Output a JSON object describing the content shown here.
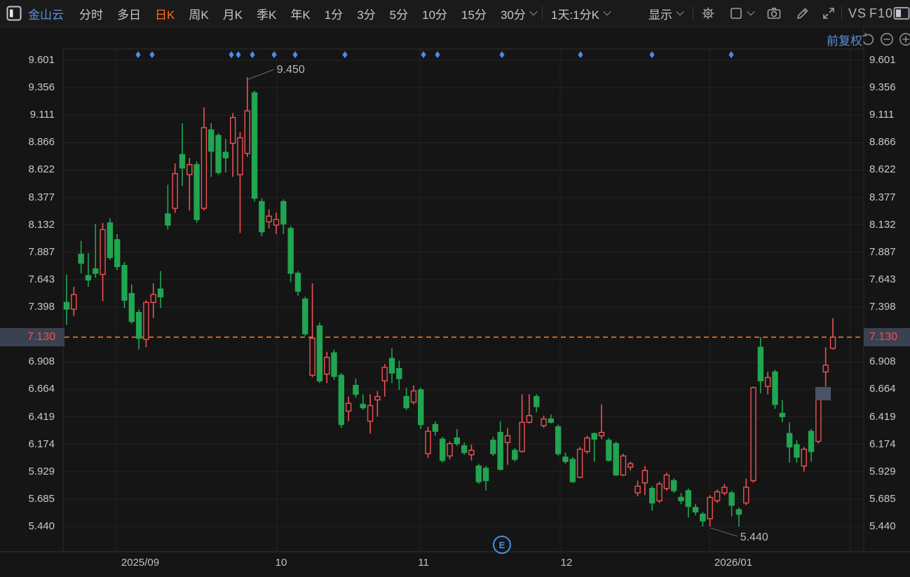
{
  "toolbar": {
    "symbol": "金山云",
    "tabs": [
      {
        "label": "分时",
        "active": false,
        "chevron": false
      },
      {
        "label": "多日",
        "active": false,
        "chevron": false
      },
      {
        "label": "日K",
        "active": true,
        "chevron": false
      },
      {
        "label": "周K",
        "active": false,
        "chevron": false
      },
      {
        "label": "月K",
        "active": false,
        "chevron": false
      },
      {
        "label": "季K",
        "active": false,
        "chevron": false
      },
      {
        "label": "年K",
        "active": false,
        "chevron": false
      },
      {
        "label": "1分",
        "active": false,
        "chevron": false
      },
      {
        "label": "3分",
        "active": false,
        "chevron": false
      },
      {
        "label": "5分",
        "active": false,
        "chevron": false
      },
      {
        "label": "10分",
        "active": false,
        "chevron": false
      },
      {
        "label": "15分",
        "active": false,
        "chevron": false
      },
      {
        "label": "30分",
        "active": false,
        "chevron": true
      }
    ],
    "period_selector": "1天:1分K",
    "display_menu": "显示",
    "vs_label": "VS",
    "f10_label": "F10",
    "icon_names": [
      "window-panel",
      "gear",
      "chart-style",
      "camera",
      "pencil",
      "fullscreen",
      "right-panel"
    ]
  },
  "chart_header": {
    "adjustment_mode": "前复权",
    "icon_names": [
      "undo",
      "zoom-out",
      "zoom-in"
    ]
  },
  "chart_data": {
    "type": "candlestick",
    "title": "金山云 日K 前复权",
    "current_price": "7.130",
    "high_annotation": "9.450",
    "low_annotation": "5.440",
    "event_marker_label": "E",
    "event_marker_x": 716,
    "y_ticks": [
      "9.601",
      "9.356",
      "9.111",
      "8.866",
      "8.622",
      "8.377",
      "8.132",
      "7.887",
      "7.643",
      "7.398",
      "6.908",
      "6.664",
      "6.419",
      "6.174",
      "5.929",
      "5.685",
      "5.440"
    ],
    "x_ticks": [
      {
        "label": "2025/09",
        "x": 200
      },
      {
        "label": "10",
        "x": 401
      },
      {
        "label": "11",
        "x": 604
      },
      {
        "label": "12",
        "x": 808
      },
      {
        "label": "2026/01",
        "x": 1046
      }
    ],
    "price_top": 9.601,
    "price_bottom": 5.44,
    "diamond_marker_xs": [
      197,
      217,
      330,
      340,
      360,
      391,
      421,
      492,
      604,
      624,
      716,
      828,
      930,
      1043
    ],
    "vertical_gridline_xs": [
      166,
      395,
      599,
      799,
      1012,
      1213
    ],
    "high_candle_index": 25,
    "low_candle_index": 89,
    "highlight_box": {
      "x": 1163,
      "y": 552,
      "w": 22,
      "h": 19
    },
    "candles": [
      [
        7.44,
        7.69,
        7.24,
        7.38
      ],
      [
        7.38,
        7.58,
        7.32,
        7.51
      ],
      [
        7.87,
        7.99,
        7.7,
        7.79
      ],
      [
        7.68,
        7.88,
        7.58,
        7.64
      ],
      [
        7.74,
        8.14,
        7.66,
        7.7
      ],
      [
        7.69,
        8.15,
        7.45,
        8.09
      ],
      [
        8.15,
        8.19,
        7.82,
        7.84
      ],
      [
        8.0,
        8.05,
        7.73,
        7.76
      ],
      [
        7.77,
        7.8,
        7.39,
        7.46
      ],
      [
        7.52,
        7.6,
        7.25,
        7.27
      ],
      [
        7.35,
        7.38,
        7.02,
        7.12
      ],
      [
        7.11,
        7.46,
        7.04,
        7.44
      ],
      [
        7.44,
        7.61,
        7.3,
        7.51
      ],
      [
        7.56,
        7.72,
        7.39,
        7.49
      ],
      [
        8.23,
        8.49,
        8.09,
        8.13
      ],
      [
        8.28,
        8.68,
        8.24,
        8.59
      ],
      [
        8.76,
        9.04,
        8.48,
        8.64
      ],
      [
        8.58,
        8.73,
        8.26,
        8.67
      ],
      [
        8.67,
        8.7,
        8.15,
        8.18
      ],
      [
        8.28,
        9.18,
        8.26,
        9.0
      ],
      [
        8.98,
        9.04,
        8.56,
        8.79
      ],
      [
        8.93,
        8.95,
        8.58,
        8.6
      ],
      [
        8.78,
        8.9,
        8.6,
        8.73
      ],
      [
        8.86,
        9.13,
        8.56,
        9.09
      ],
      [
        8.58,
        8.96,
        8.06,
        8.91
      ],
      [
        8.77,
        9.45,
        8.74,
        9.15
      ],
      [
        9.31,
        9.33,
        8.34,
        8.37
      ],
      [
        8.34,
        8.37,
        8.03,
        8.07
      ],
      [
        8.16,
        8.27,
        8.1,
        8.21
      ],
      [
        8.13,
        8.24,
        8.05,
        8.18
      ],
      [
        8.34,
        8.36,
        8.05,
        8.14
      ],
      [
        8.1,
        8.12,
        7.62,
        7.7
      ],
      [
        7.7,
        7.72,
        7.5,
        7.54
      ],
      [
        7.47,
        7.49,
        7.14,
        7.16
      ],
      [
        6.79,
        7.61,
        6.77,
        7.12
      ],
      [
        7.23,
        7.26,
        6.72,
        6.74
      ],
      [
        6.8,
        7.0,
        6.72,
        6.95
      ],
      [
        6.99,
        7.02,
        6.75,
        6.78
      ],
      [
        6.79,
        6.81,
        6.32,
        6.35
      ],
      [
        6.47,
        6.6,
        6.38,
        6.54
      ],
      [
        6.7,
        6.76,
        6.59,
        6.62
      ],
      [
        6.53,
        6.62,
        6.48,
        6.5
      ],
      [
        6.38,
        6.62,
        6.27,
        6.52
      ],
      [
        6.57,
        6.65,
        6.42,
        6.6
      ],
      [
        6.74,
        6.89,
        6.6,
        6.86
      ],
      [
        6.94,
        7.03,
        6.72,
        6.81
      ],
      [
        6.85,
        6.92,
        6.66,
        6.76
      ],
      [
        6.6,
        6.68,
        6.48,
        6.5
      ],
      [
        6.55,
        6.7,
        6.53,
        6.65
      ],
      [
        6.66,
        6.68,
        6.31,
        6.35
      ],
      [
        6.09,
        6.33,
        6.05,
        6.29
      ],
      [
        6.35,
        6.38,
        6.25,
        6.29
      ],
      [
        6.22,
        6.24,
        6.01,
        6.03
      ],
      [
        6.07,
        6.2,
        6.04,
        6.18
      ],
      [
        6.23,
        6.31,
        6.16,
        6.18
      ],
      [
        6.16,
        6.19,
        6.08,
        6.1
      ],
      [
        6.08,
        6.17,
        6.03,
        6.12
      ],
      [
        5.98,
        6.0,
        5.82,
        5.84
      ],
      [
        5.96,
        5.98,
        5.76,
        5.85
      ],
      [
        6.21,
        6.24,
        6.07,
        6.09
      ],
      [
        6.28,
        6.38,
        5.94,
        5.95
      ],
      [
        6.19,
        6.32,
        5.99,
        6.25
      ],
      [
        6.12,
        6.14,
        6.02,
        6.04
      ],
      [
        6.11,
        6.62,
        6.1,
        6.37
      ],
      [
        6.37,
        6.62,
        6.36,
        6.43
      ],
      [
        6.6,
        6.62,
        6.46,
        6.51
      ],
      [
        6.34,
        6.43,
        6.32,
        6.4
      ],
      [
        6.4,
        6.44,
        6.36,
        6.37
      ],
      [
        6.33,
        6.35,
        6.07,
        6.09
      ],
      [
        6.06,
        6.1,
        6.0,
        6.02
      ],
      [
        6.04,
        6.06,
        5.83,
        5.84
      ],
      [
        5.88,
        6.15,
        5.87,
        6.13
      ],
      [
        6.11,
        6.25,
        6.09,
        6.23
      ],
      [
        6.27,
        6.28,
        6.02,
        6.22
      ],
      [
        6.25,
        6.53,
        6.22,
        6.28
      ],
      [
        6.21,
        6.23,
        6.02,
        6.03
      ],
      [
        6.18,
        6.2,
        5.89,
        5.9
      ],
      [
        5.9,
        6.09,
        5.89,
        6.07
      ],
      [
        5.97,
        6.02,
        5.94,
        6.0
      ],
      [
        5.74,
        5.85,
        5.71,
        5.8
      ],
      [
        5.83,
        5.98,
        5.72,
        5.94
      ],
      [
        5.78,
        5.8,
        5.58,
        5.65
      ],
      [
        5.67,
        5.84,
        5.65,
        5.82
      ],
      [
        5.78,
        5.92,
        5.76,
        5.9
      ],
      [
        5.85,
        5.87,
        5.74,
        5.76
      ],
      [
        5.7,
        5.74,
        5.64,
        5.67
      ],
      [
        5.76,
        5.78,
        5.52,
        5.62
      ],
      [
        5.61,
        5.64,
        5.54,
        5.57
      ],
      [
        5.55,
        5.57,
        5.44,
        5.49
      ],
      [
        5.51,
        5.72,
        5.44,
        5.7
      ],
      [
        5.67,
        5.77,
        5.65,
        5.75
      ],
      [
        5.74,
        5.82,
        5.72,
        5.79
      ],
      [
        5.74,
        5.76,
        5.53,
        5.63
      ],
      [
        5.59,
        5.61,
        5.44,
        5.55
      ],
      [
        5.65,
        5.87,
        5.63,
        5.79
      ],
      [
        5.85,
        6.69,
        5.83,
        6.68
      ],
      [
        7.04,
        7.13,
        6.63,
        6.74
      ],
      [
        6.69,
        6.82,
        6.62,
        6.77
      ],
      [
        6.82,
        6.84,
        6.49,
        6.53
      ],
      [
        6.45,
        6.57,
        6.37,
        6.42
      ],
      [
        6.27,
        6.37,
        6.01,
        6.15
      ],
      [
        6.17,
        6.21,
        6.01,
        6.06
      ],
      [
        5.98,
        6.15,
        5.93,
        6.13
      ],
      [
        6.29,
        6.31,
        6.02,
        6.11
      ],
      [
        6.2,
        6.68,
        6.18,
        6.66
      ],
      [
        6.82,
        7.04,
        6.69,
        6.88
      ],
      [
        7.03,
        7.3,
        7.02,
        7.13
      ]
    ],
    "colors": {
      "up": "#f05151",
      "down": "#21a551",
      "dashed_line": "#f5761f",
      "diamond": "#4a8ee8",
      "price_badge_bg": "#3a4150",
      "price_badge_text": "#f34f4f",
      "grid": "#242424",
      "annotation_text": "#b3b9c2"
    }
  }
}
